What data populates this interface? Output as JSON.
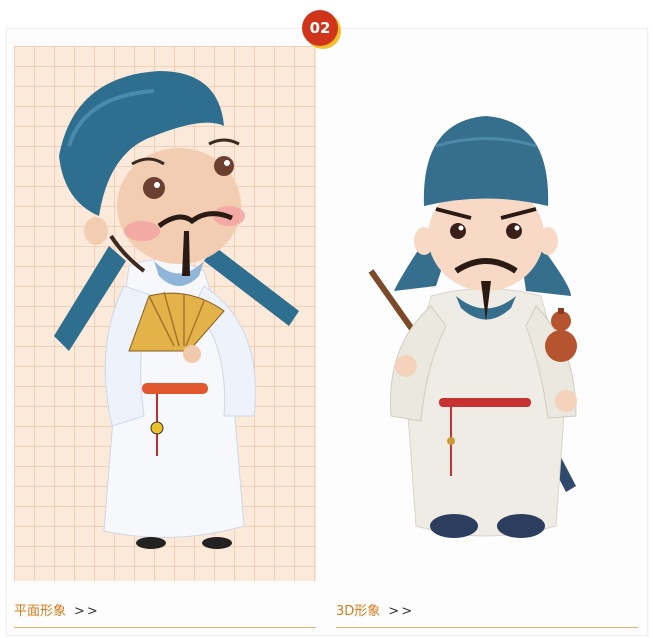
{
  "badge": {
    "number": "02"
  },
  "panels": [
    {
      "caption": "平面形象",
      "arrows": ">>"
    },
    {
      "caption": "3D形象",
      "arrows": ">>"
    }
  ],
  "colors": {
    "badge_red": "#d0351c",
    "badge_shadow": "#f3bf2a",
    "caption_orange": "#d67a1a",
    "hat_blue": "#2e6e8e",
    "panel_peach": "#fbe9d9"
  }
}
